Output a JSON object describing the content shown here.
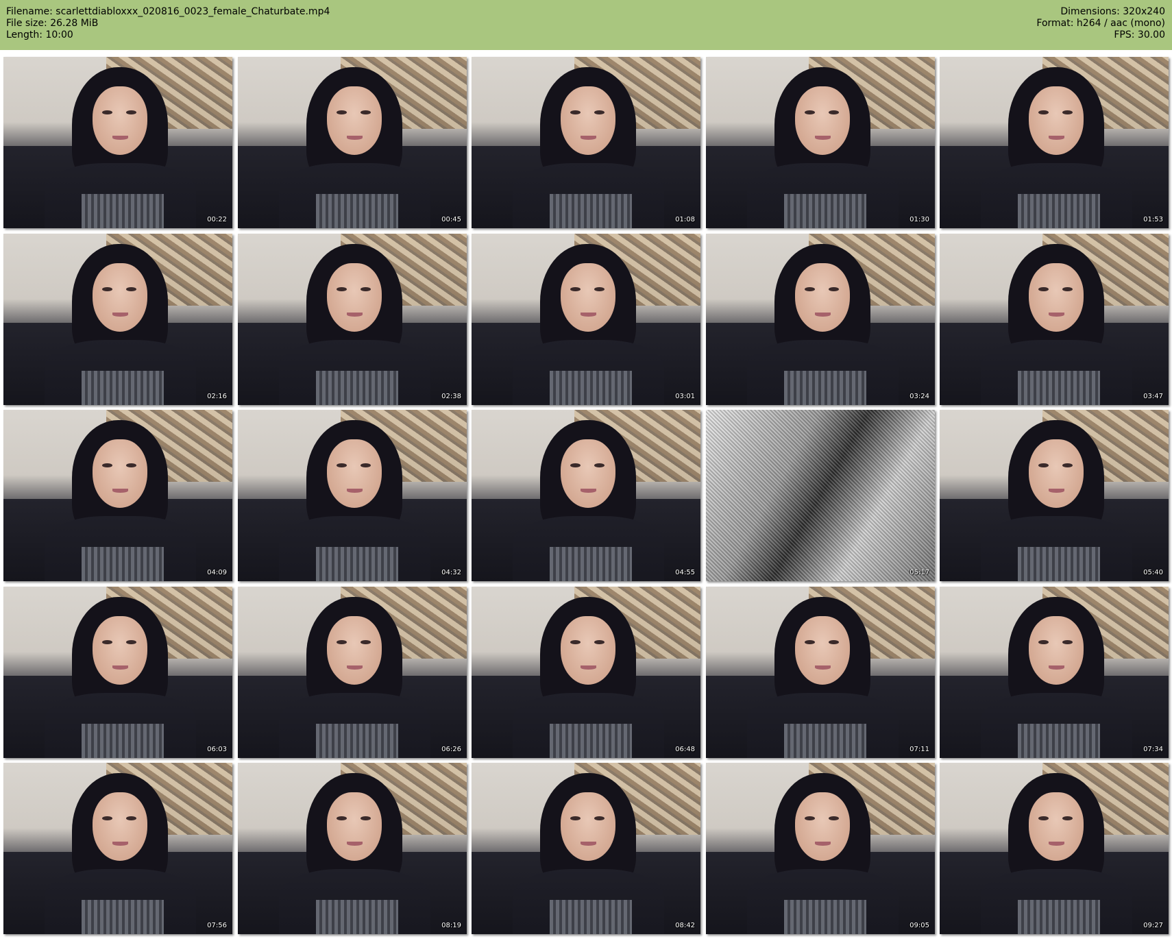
{
  "info": {
    "filename": "Filename: scarlettdiabloxxx_020816_0023_female_Chaturbate.mp4",
    "file_size": "File size: 26.28 MiB",
    "length": "Length: 10:00",
    "dimensions": "Dimensions: 320x240",
    "format": "Format: h264 / aac (mono)",
    "fps": "FPS: 30.00"
  },
  "colors": {
    "header_bg": "#a9c67f",
    "page_bg": "#ffffff",
    "timestamp": "#ffffff"
  },
  "thumbnails": [
    {
      "time": "00:22",
      "kind": "portrait"
    },
    {
      "time": "00:45",
      "kind": "portrait"
    },
    {
      "time": "01:08",
      "kind": "portrait"
    },
    {
      "time": "01:30",
      "kind": "portrait"
    },
    {
      "time": "01:53",
      "kind": "portrait"
    },
    {
      "time": "02:16",
      "kind": "portrait"
    },
    {
      "time": "02:38",
      "kind": "portrait"
    },
    {
      "time": "03:01",
      "kind": "portrait"
    },
    {
      "time": "03:24",
      "kind": "portrait"
    },
    {
      "time": "03:47",
      "kind": "portrait"
    },
    {
      "time": "04:09",
      "kind": "portrait"
    },
    {
      "time": "04:32",
      "kind": "portrait"
    },
    {
      "time": "04:55",
      "kind": "portrait"
    },
    {
      "time": "05:17",
      "kind": "closeup"
    },
    {
      "time": "05:40",
      "kind": "portrait"
    },
    {
      "time": "06:03",
      "kind": "portrait"
    },
    {
      "time": "06:26",
      "kind": "portrait"
    },
    {
      "time": "06:48",
      "kind": "portrait"
    },
    {
      "time": "07:11",
      "kind": "portrait"
    },
    {
      "time": "07:34",
      "kind": "portrait"
    },
    {
      "time": "07:56",
      "kind": "portrait"
    },
    {
      "time": "08:19",
      "kind": "portrait"
    },
    {
      "time": "08:42",
      "kind": "portrait"
    },
    {
      "time": "09:05",
      "kind": "portrait"
    },
    {
      "time": "09:27",
      "kind": "portrait"
    }
  ]
}
